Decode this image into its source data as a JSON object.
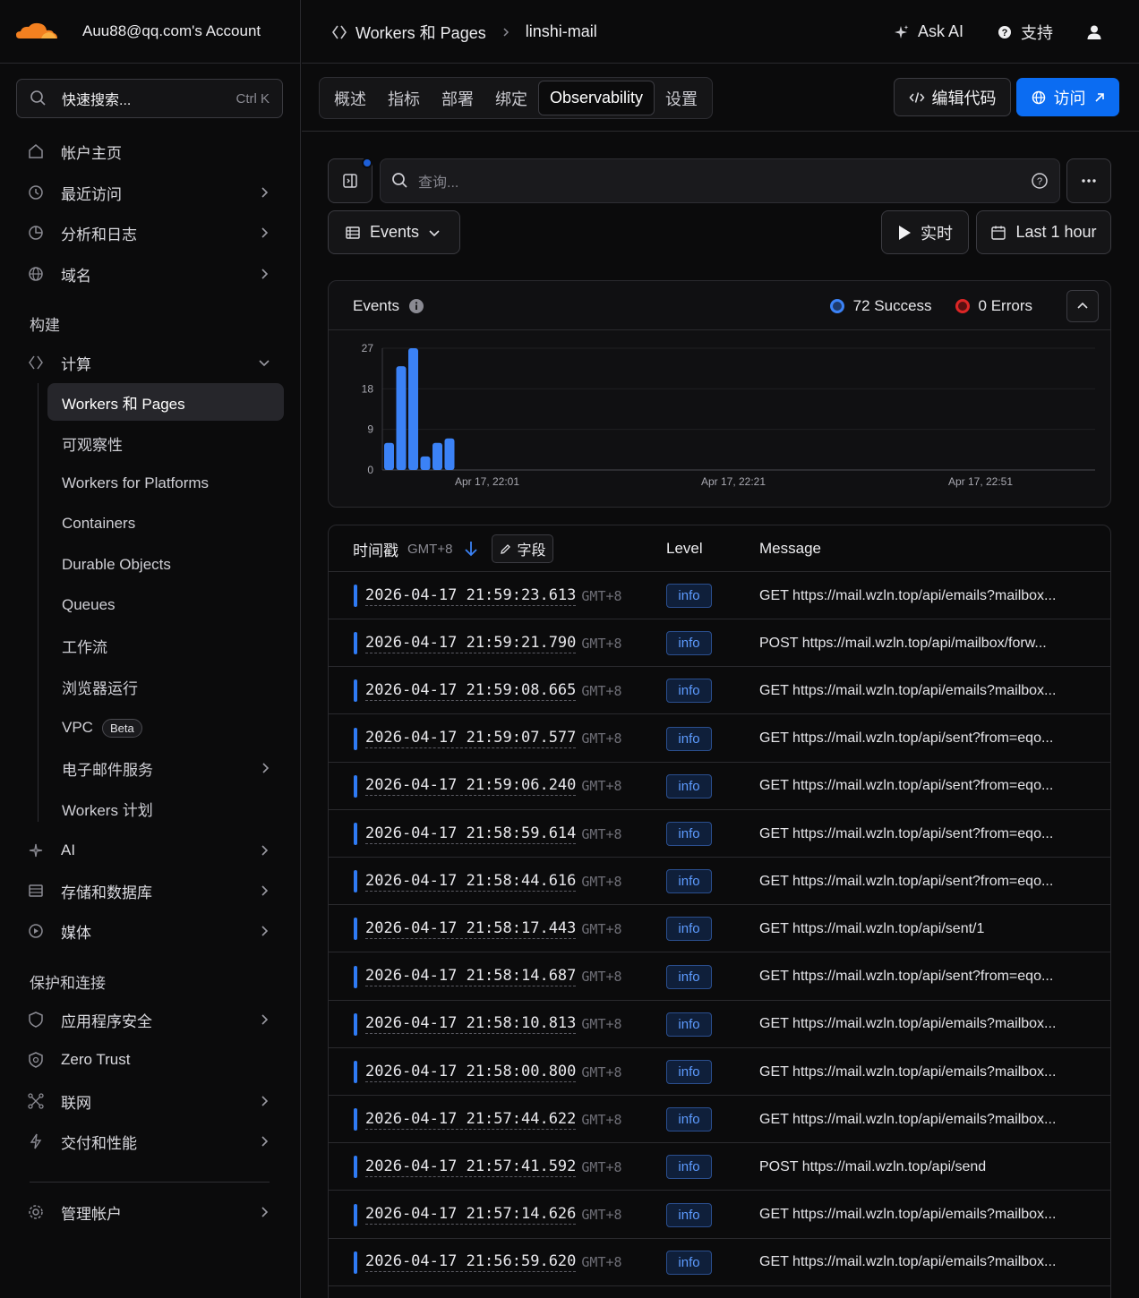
{
  "account": {
    "name": "Auu88@qq.com's Account"
  },
  "search": {
    "placeholder": "快速搜索...",
    "shortcut": "Ctrl K"
  },
  "sidebar": {
    "top_items": [
      {
        "label": "帐户主页",
        "icon": "home-icon"
      },
      {
        "label": "最近访问",
        "icon": "clock-icon"
      },
      {
        "label": "分析和日志",
        "icon": "chart-pie-icon"
      },
      {
        "label": "域名",
        "icon": "globe-icon"
      }
    ],
    "section_build": "构建",
    "compute_label": "计算",
    "compute_items": [
      {
        "label": "Workers 和 Pages"
      },
      {
        "label": "可观察性"
      },
      {
        "label": "Workers for Platforms"
      },
      {
        "label": "Containers"
      },
      {
        "label": "Durable Objects"
      },
      {
        "label": "Queues"
      },
      {
        "label": "工作流"
      },
      {
        "label": "浏览器运行"
      },
      {
        "label": "VPC",
        "badge": "Beta"
      },
      {
        "label": "电子邮件服务"
      },
      {
        "label": "Workers 计划"
      }
    ],
    "build_items": [
      {
        "label": "AI",
        "icon": "sparkle-icon"
      },
      {
        "label": "存储和数据库",
        "icon": "database-icon"
      },
      {
        "label": "媒体",
        "icon": "play-icon"
      }
    ],
    "section_protect": "保护和连接",
    "protect_items": [
      {
        "label": "应用程序安全",
        "icon": "shield-icon"
      },
      {
        "label": "Zero Trust",
        "icon": "zero-trust-icon"
      },
      {
        "label": "联网",
        "icon": "network-icon"
      },
      {
        "label": "交付和性能",
        "icon": "bolt-icon"
      }
    ],
    "manage_label": "管理帐户"
  },
  "breadcrumb": {
    "root": "Workers 和 Pages",
    "current": "linshi-mail"
  },
  "topbar": {
    "ask_ai": "Ask AI",
    "support": "支持"
  },
  "tabs": [
    "概述",
    "指标",
    "部署",
    "绑定",
    "Observability",
    "设置"
  ],
  "active_tab": "Observability",
  "actions": {
    "edit_code": "编辑代码",
    "visit": "访问"
  },
  "query": {
    "placeholder": "查询..."
  },
  "view": {
    "events_label": "Events",
    "live_label": "实时",
    "range_label": "Last 1 hour"
  },
  "chart_panel": {
    "title": "Events",
    "success_label": "72 Success",
    "errors_label": "0 Errors",
    "colors": {
      "success": "#3b82f6",
      "error": "#dc2626"
    }
  },
  "chart_data": {
    "type": "bar",
    "y_ticks": [
      "27",
      "18",
      "9",
      "0"
    ],
    "ylim": [
      0,
      27
    ],
    "x_tick_labels": [
      "Apr 17, 22:01",
      "Apr 17, 22:21",
      "Apr 17, 22:51"
    ],
    "values": [
      6,
      23,
      27,
      3,
      6,
      7
    ]
  },
  "table": {
    "col_timestamp": "时间戳",
    "col_timestamp_tz": "GMT+8",
    "field_button": "字段",
    "col_level": "Level",
    "col_message": "Message",
    "rows": [
      {
        "ts": "2026-04-17 21:59:23.613",
        "tz": "GMT+8",
        "level": "info",
        "msg": "GET https://mail.wzln.top/api/emails?mailbox..."
      },
      {
        "ts": "2026-04-17 21:59:21.790",
        "tz": "GMT+8",
        "level": "info",
        "msg": "POST https://mail.wzln.top/api/mailbox/forw..."
      },
      {
        "ts": "2026-04-17 21:59:08.665",
        "tz": "GMT+8",
        "level": "info",
        "msg": "GET https://mail.wzln.top/api/emails?mailbox..."
      },
      {
        "ts": "2026-04-17 21:59:07.577",
        "tz": "GMT+8",
        "level": "info",
        "msg": "GET https://mail.wzln.top/api/sent?from=eqo..."
      },
      {
        "ts": "2026-04-17 21:59:06.240",
        "tz": "GMT+8",
        "level": "info",
        "msg": "GET https://mail.wzln.top/api/sent?from=eqo..."
      },
      {
        "ts": "2026-04-17 21:58:59.614",
        "tz": "GMT+8",
        "level": "info",
        "msg": "GET https://mail.wzln.top/api/sent?from=eqo..."
      },
      {
        "ts": "2026-04-17 21:58:44.616",
        "tz": "GMT+8",
        "level": "info",
        "msg": "GET https://mail.wzln.top/api/sent?from=eqo..."
      },
      {
        "ts": "2026-04-17 21:58:17.443",
        "tz": "GMT+8",
        "level": "info",
        "msg": "GET https://mail.wzln.top/api/sent/1"
      },
      {
        "ts": "2026-04-17 21:58:14.687",
        "tz": "GMT+8",
        "level": "info",
        "msg": "GET https://mail.wzln.top/api/sent?from=eqo..."
      },
      {
        "ts": "2026-04-17 21:58:10.813",
        "tz": "GMT+8",
        "level": "info",
        "msg": "GET https://mail.wzln.top/api/emails?mailbox..."
      },
      {
        "ts": "2026-04-17 21:58:00.800",
        "tz": "GMT+8",
        "level": "info",
        "msg": "GET https://mail.wzln.top/api/emails?mailbox..."
      },
      {
        "ts": "2026-04-17 21:57:44.622",
        "tz": "GMT+8",
        "level": "info",
        "msg": "GET https://mail.wzln.top/api/emails?mailbox..."
      },
      {
        "ts": "2026-04-17 21:57:41.592",
        "tz": "GMT+8",
        "level": "info",
        "msg": "POST https://mail.wzln.top/api/send"
      },
      {
        "ts": "2026-04-17 21:57:14.626",
        "tz": "GMT+8",
        "level": "info",
        "msg": "GET https://mail.wzln.top/api/emails?mailbox..."
      },
      {
        "ts": "2026-04-17 21:56:59.620",
        "tz": "GMT+8",
        "level": "info",
        "msg": "GET https://mail.wzln.top/api/emails?mailbox..."
      }
    ]
  }
}
